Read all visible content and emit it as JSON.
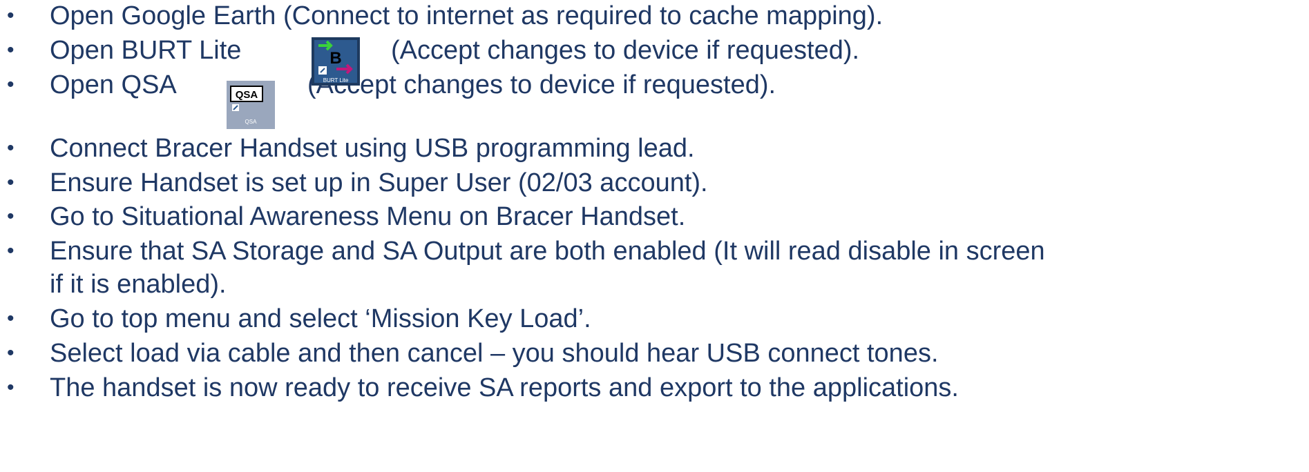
{
  "bullets_group1": [
    {
      "prefix": "Open Google Earth (Connect to internet as required to cache mapping)."
    },
    {
      "prefix": "Open BURT Lite",
      "suffix": "(Accept changes to device if requested)."
    },
    {
      "prefix": "Open QSA",
      "suffix": "(Accept changes to device if requested)."
    }
  ],
  "bullets_group2": [
    "Connect Bracer Handset using USB programming lead.",
    "Ensure Handset is set up in Super User (02/03 account).",
    "Go to Situational Awareness Menu on Bracer Handset.",
    "Ensure that SA Storage and SA Output are both enabled (It will read disable in screen",
    "if it is enabled).",
    "Go to top menu and select ‘Mission Key Load’.",
    "Select load via cable and then cancel – you should hear USB connect tones.",
    "The handset is now ready to receive SA reports and export to the applications."
  ],
  "icons": {
    "burt": {
      "label": "BURT Lite",
      "glyph": "B"
    },
    "qsa": {
      "label": "QSA",
      "glyph": "QSA"
    }
  },
  "bullet_char": "•",
  "colors": {
    "text": "#1f3864",
    "burt_bg": "#1e3a5f",
    "qsa_bg": "#9aa7bd"
  }
}
